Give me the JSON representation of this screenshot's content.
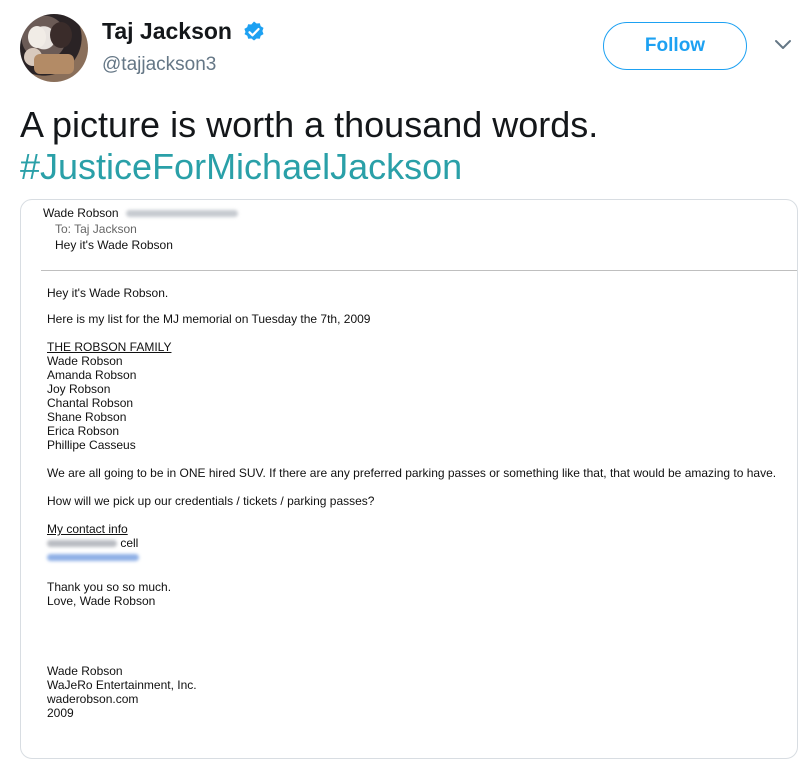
{
  "user": {
    "display_name": "Taj Jackson",
    "handle": "@tajjackson3",
    "verified_icon": "verified-badge-icon",
    "accent": "#1da1f2"
  },
  "actions": {
    "follow_label": "Follow",
    "more_icon": "chevron-down-icon"
  },
  "tweet": {
    "text": "A picture is worth a thousand words.",
    "hashtag": "#JusticeForMichaelJackson"
  },
  "email": {
    "from_name": "Wade Robson",
    "to_line": "To:  Taj Jackson",
    "subject": "Hey it's Wade Robson",
    "greeting": "Hey it's Wade Robson.",
    "intro": "Here is my list for the MJ memorial on Tuesday the 7th, 2009",
    "family_heading": "THE ROBSON FAMILY",
    "family": [
      "Wade Robson",
      "Amanda Robson",
      "Joy Robson",
      "Chantal Robson",
      "Shane Robson",
      "Erica Robson",
      "Phillipe Casseus"
    ],
    "suv_note": "We are all going to be in ONE hired SUV. If there are any preferred parking passes or something like that, that would be amazing to have.",
    "question": "How will we pick up our credentials / tickets / parking passes?",
    "contact_heading": "My contact info",
    "cell_label": "cell",
    "thanks": "Thank you so so much.",
    "love": "Love, Wade Robson",
    "signature": [
      "Wade Robson",
      "WaJeRo Entertainment, Inc.",
      "waderobson.com",
      "2009"
    ]
  }
}
